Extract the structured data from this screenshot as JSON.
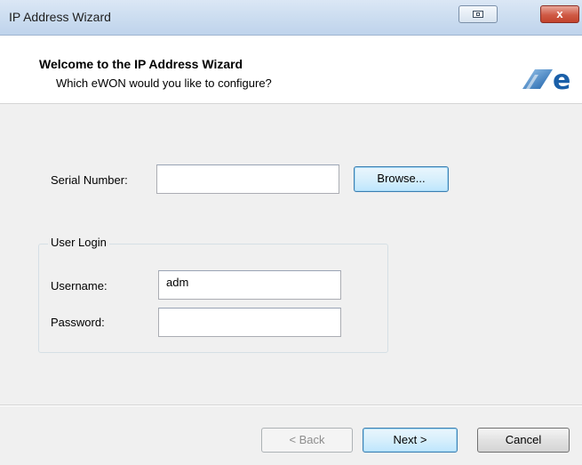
{
  "window": {
    "title": "IP Address Wizard",
    "close_glyph": "x"
  },
  "header": {
    "title": "Welcome to the IP Address Wizard",
    "subtitle": "Which eWON would you like to configure?",
    "logo_text": "e"
  },
  "form": {
    "serial_label": "Serial Number:",
    "serial_value": "",
    "browse_label": "Browse...",
    "group_title": "User Login",
    "username_label": "Username:",
    "username_value": "adm",
    "password_label": "Password:",
    "password_value": ""
  },
  "footer": {
    "back_label": "< Back",
    "next_label": "Next >",
    "cancel_label": "Cancel"
  },
  "colors": {
    "accent": "#3c7fb1",
    "close_red": "#c2432c",
    "logo_blue": "#1a5fa8"
  }
}
